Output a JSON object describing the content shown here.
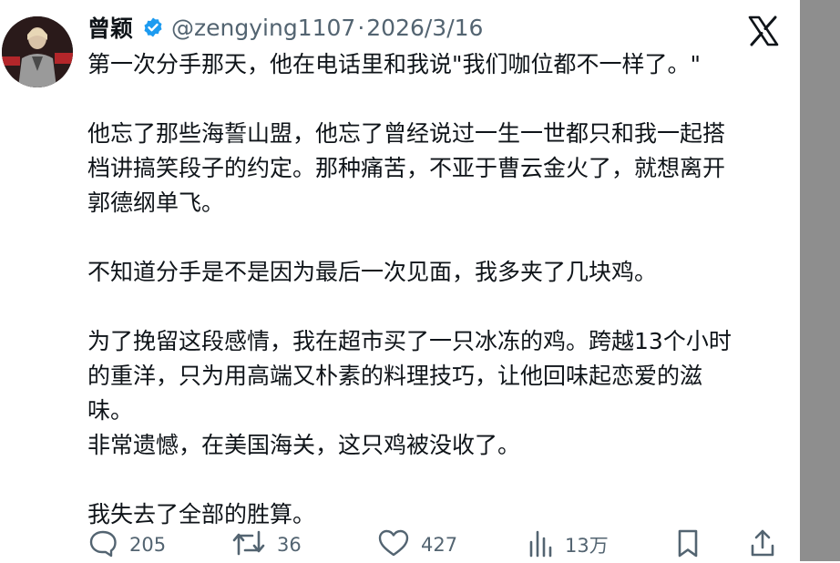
{
  "author": {
    "name": "曾颖",
    "handle": "@zengying1107",
    "separator": "·",
    "date": "2026/3/16",
    "verified_color": "#1d9bf0"
  },
  "post": {
    "paragraphs": [
      [
        "第一次分手那天，他在电话里和我说\"我们咖位都不一样了。\""
      ],
      [
        "他忘了那些海誓山盟，他忘了曾经说过一生一世都只和我一起搭",
        "档讲搞笑段子的约定。那种痛苦，不亚于曹云金火了，就想离开",
        "郭德纲单飞。"
      ],
      [
        "不知道分手是不是因为最后一次见面，我多夹了几块鸡。"
      ],
      [
        "为了挽留这段感情，我在超市买了一只冰冻的鸡。跨越13个小时",
        "的重洋，只为用高端又朴素的料理技巧，让他回味起恋爱的滋",
        "味。",
        "非常遗憾，在美国海关，这只鸡被没收了。"
      ],
      [
        "我失去了全部的胜算。"
      ]
    ]
  },
  "actions": {
    "replies": "205",
    "reposts": "36",
    "likes": "427",
    "views": "13万"
  },
  "icons": {
    "verified": "verified-badge-icon",
    "platform": "x-logo-icon",
    "reply": "reply-icon",
    "repost": "repost-icon",
    "like": "heart-icon",
    "views": "views-bar-chart-icon",
    "bookmark": "bookmark-icon",
    "share": "share-icon"
  },
  "colors": {
    "text": "#0f1419",
    "muted": "#536471",
    "scrollbar": "#8e8e8e"
  }
}
